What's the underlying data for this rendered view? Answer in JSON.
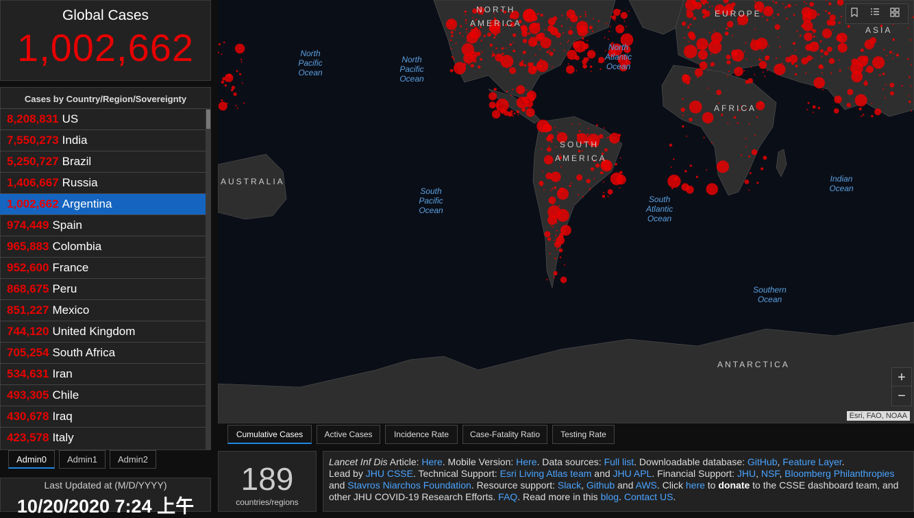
{
  "global": {
    "title": "Global Cases",
    "value": "1,002,662"
  },
  "list": {
    "header": "Cases by Country/Region/Sovereignty",
    "rows": [
      {
        "n": "8,208,831",
        "c": "US"
      },
      {
        "n": "7,550,273",
        "c": "India"
      },
      {
        "n": "5,250,727",
        "c": "Brazil"
      },
      {
        "n": "1,406,667",
        "c": "Russia"
      },
      {
        "n": "1,002,662",
        "c": "Argentina",
        "selected": true
      },
      {
        "n": "974,449",
        "c": "Spain"
      },
      {
        "n": "965,883",
        "c": "Colombia"
      },
      {
        "n": "952,600",
        "c": "France"
      },
      {
        "n": "868,675",
        "c": "Peru"
      },
      {
        "n": "851,227",
        "c": "Mexico"
      },
      {
        "n": "744,120",
        "c": "United Kingdom"
      },
      {
        "n": "705,254",
        "c": "South Africa"
      },
      {
        "n": "534,631",
        "c": "Iran"
      },
      {
        "n": "493,305",
        "c": "Chile"
      },
      {
        "n": "430,678",
        "c": "Iraq"
      },
      {
        "n": "423,578",
        "c": "Italy"
      }
    ]
  },
  "admin_tabs": [
    "Admin0",
    "Admin1",
    "Admin2"
  ],
  "updated": {
    "label": "Last Updated at (M/D/YYYY)",
    "value": "10/20/2020 7:24 上午"
  },
  "map": {
    "continents": [
      "NORTH",
      "AMERICA",
      "EUROPE",
      "ASIA",
      "AFRICA",
      "SOUTH",
      "AMERICA",
      "AUSTRALIA",
      "ANTARCTICA"
    ],
    "oceans": [
      [
        "North",
        "Pacific",
        "Ocean"
      ],
      [
        "North",
        "Pacific",
        "Ocean"
      ],
      [
        "North",
        "Atlantic",
        "Ocean"
      ],
      [
        "South",
        "Pacific",
        "Ocean"
      ],
      [
        "South",
        "Atlantic",
        "Ocean"
      ],
      [
        "Indian",
        "Ocean"
      ],
      [
        "Southern",
        "Ocean"
      ]
    ],
    "attribution": "Esri, FAO, NOAA",
    "zoom_in": "+",
    "zoom_out": "−",
    "toolbar_icons": [
      "bookmark-icon",
      "list-icon",
      "grid-icon"
    ]
  },
  "view_tabs": [
    "Cumulative Cases",
    "Active Cases",
    "Incidence Rate",
    "Case-Fatality Ratio",
    "Testing Rate"
  ],
  "count": {
    "value": "189",
    "label": "countries/regions"
  },
  "info": {
    "l1": [
      "Lancet Inf Dis",
      " Article: ",
      "Here",
      ". Mobile Version: ",
      "Here",
      ". Data sources: ",
      "Full list",
      ". Downloadable database: ",
      "GitHub",
      ", ",
      "Feature Layer",
      "."
    ],
    "l2": [
      "Lead by ",
      "JHU CSSE",
      ". Technical Support: ",
      "Esri Living Atlas team",
      " and ",
      "JHU APL",
      ". Financial Support: ",
      "JHU",
      ", ",
      "NSF",
      ", ",
      "Bloomberg Philanthropies"
    ],
    "l3": [
      "and ",
      "Stavros Niarchos Foundation",
      ". Resource support: ",
      "Slack",
      ", ",
      "Github",
      " and ",
      "AWS",
      ". Click ",
      "here",
      " to ",
      "donate",
      " to the CSSE dashboard team, and"
    ],
    "l4": [
      "other JHU COVID-19 Research Efforts. ",
      "FAQ",
      ". Read more in this ",
      "blog",
      ". ",
      "Contact US",
      "."
    ]
  },
  "colors": {
    "accent": "#e60000",
    "selected": "#1565c0",
    "link": "#4aa3ff"
  }
}
